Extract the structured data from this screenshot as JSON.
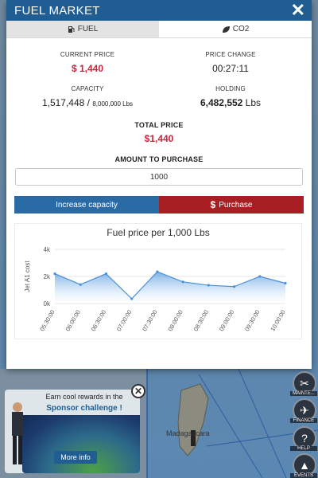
{
  "modal": {
    "title": "FUEL MARKET",
    "tabs": [
      {
        "label": "FUEL",
        "icon": "fuel-pump-icon",
        "active": true
      },
      {
        "label": "CO2",
        "icon": "leaf-icon",
        "active": false
      }
    ],
    "current_price_label": "CURRENT PRICE",
    "current_price_value": "$ 1,440",
    "price_change_label": "PRICE CHANGE",
    "price_change_value": "00:27:11",
    "capacity_label": "CAPACITY",
    "capacity_value": "1,517,448 / ",
    "capacity_max": "8,000,000 Lbs",
    "holding_label": "HOLDING",
    "holding_value": "6,482,552",
    "holding_unit": " Lbs",
    "total_price_label": "TOTAL PRICE",
    "total_price_value": "$1,440",
    "amount_label": "AMOUNT TO PURCHASE",
    "amount_value": "1000",
    "increase_capacity_label": "Increase capacity",
    "purchase_label": "Purchase",
    "accent_blue": "#1f5d93",
    "accent_red": "#a81f23"
  },
  "chart_data": {
    "type": "area",
    "title": "Fuel price per 1,000 Lbs",
    "ylabel": "Jet A1 cost",
    "xlabel": "",
    "ylim": [
      0,
      4000
    ],
    "yticks": [
      "0k",
      "2k",
      "4k"
    ],
    "categories": [
      "05:30:00",
      "06:00:00",
      "06:30:00",
      "07:00:00",
      "07:30:00",
      "08:00:00",
      "08:30:00",
      "09:00:00",
      "09:30:00",
      "10:00:00"
    ],
    "x": [
      0,
      0.75,
      1.5,
      2.25,
      3,
      3.75,
      4.5,
      5.25,
      6,
      6.75
    ],
    "values": [
      2200,
      1400,
      2200,
      350,
      2350,
      1600,
      1350,
      1250,
      2000,
      1500
    ],
    "color": "#4a90d9"
  },
  "sponsor": {
    "line1": "Earn cool rewards in the",
    "line2": "Sponsor challenge !",
    "button": "More info"
  },
  "map": {
    "label": "Madagascara"
  },
  "side_menu": [
    {
      "label": "MAINTE...",
      "icon": "wrench-icon"
    },
    {
      "label": "FINANCE",
      "icon": "finance-icon"
    },
    {
      "label": "HELP",
      "icon": "help-icon"
    },
    {
      "label": "EVENTS",
      "icon": "events-icon"
    }
  ]
}
